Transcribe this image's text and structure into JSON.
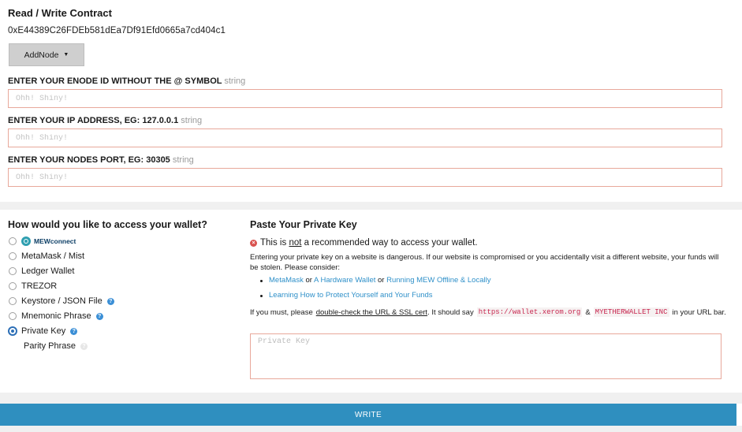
{
  "contract": {
    "title": "Read / Write Contract",
    "address": "0xE44389C26FDEb581dEa7Df91Efd0665a7cd404c1",
    "function_select": "AddNode"
  },
  "fields": [
    {
      "label": "ENTER YOUR ENODE ID WITHOUT THE @ SYMBOL",
      "type": "string",
      "placeholder": "Ohh! Shiny!",
      "value": ""
    },
    {
      "label": "ENTER YOUR IP ADDRESS, EG: 127.0.0.1",
      "type": "string",
      "placeholder": "Ohh! Shiny!",
      "value": ""
    },
    {
      "label": "ENTER YOUR NODES PORT, EG: 30305",
      "type": "string",
      "placeholder": "Ohh! Shiny!",
      "value": ""
    }
  ],
  "access": {
    "title": "How would you like to access your wallet?",
    "options": [
      {
        "label": "MEWconnect",
        "icon": "mewconnect-logo-icon",
        "checked": false
      },
      {
        "label": "MetaMask / Mist",
        "checked": false
      },
      {
        "label": "Ledger Wallet",
        "checked": false
      },
      {
        "label": "TREZOR",
        "checked": false
      },
      {
        "label": "Keystore / JSON File",
        "help": true,
        "checked": false
      },
      {
        "label": "Mnemonic Phrase",
        "help": true,
        "checked": false
      },
      {
        "label": "Private Key",
        "help": true,
        "checked": true
      }
    ],
    "sub_option": {
      "label": "Parity Phrase"
    }
  },
  "private_key": {
    "title": "Paste Your Private Key",
    "warning_pre": "This is",
    "warning_not": "not",
    "warning_post": "a recommended way to access your wallet.",
    "paragraph": "Entering your private key on a website is dangerous. If our website is compromised or you accidentally visit a different website, your funds will be stolen. Please consider:",
    "bullet1": {
      "link1": "MetaMask",
      "or1": "or",
      "link2": "A Hardware Wallet",
      "or2": "or",
      "link3": "Running MEW Offline & Locally"
    },
    "bullet2": {
      "link": "Learning How to Protect Yourself and Your Funds"
    },
    "must": {
      "pre": "If you must, please",
      "check": "double-check the URL & SSL cert",
      "mid": ". It should say",
      "url": "https://wallet.xerom.org",
      "amp": "&",
      "inc": "MYETHERWALLET INC",
      "post": "in your URL bar."
    },
    "placeholder": "Private Key",
    "value": ""
  },
  "write_button": "WRITE",
  "colors": {
    "accent": "#2f8fbf",
    "input_border": "#e8a89b",
    "link": "#2f90c9",
    "danger": "#d9534f"
  }
}
